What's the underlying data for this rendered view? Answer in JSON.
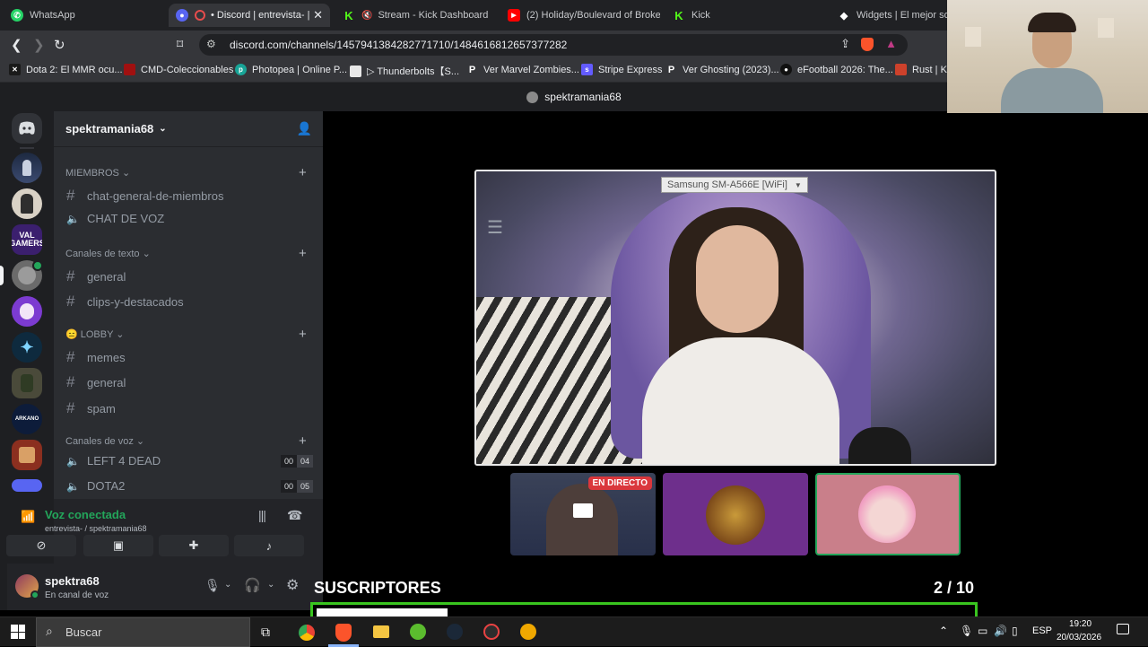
{
  "browser": {
    "tabs": [
      {
        "label": "WhatsApp",
        "icon": "whatsapp-icon",
        "active": false
      },
      {
        "label": "• Discord | entrevista- | s",
        "icon": "discord-icon",
        "active": true
      },
      {
        "label": "Stream - Kick Dashboard",
        "icon": "kick-icon",
        "active": false
      },
      {
        "label": "(2) Holiday/Boulevard of Broken",
        "icon": "youtube-icon",
        "active": false
      },
      {
        "label": "Kick",
        "icon": "kick-icon",
        "active": false
      },
      {
        "label": "Widgets | El mejor softw",
        "icon": "widget-icon",
        "active": false
      }
    ],
    "url": "discord.com/channels/1457941384282771710/1484616812657377282",
    "bookmarks": [
      "Dota 2: El MMR ocu...",
      "CMD-Coleccionables",
      "Photopea | Online P...",
      "▷ Thunderbolts【S...",
      "Ver Marvel Zombies...",
      "Stripe Express",
      "Ver Ghosting (2023)...",
      "eFootball 2026: The...",
      "Rust | Kic"
    ]
  },
  "discord": {
    "top_title": "spektramania68",
    "server_name": "spektramania68",
    "categories": {
      "miembros": "MIEMBROS",
      "texto": "Canales de texto",
      "lobby": "😑 LOBBY",
      "voz": "Canales de voz"
    },
    "channels": {
      "chat_general": "chat-general-de-miembros",
      "chat_voz": "CHAT DE VOZ",
      "general1": "general",
      "clips": "clips-y-destacados",
      "memes": "memes",
      "general2": "general",
      "spam": "spam",
      "l4d": "LEFT 4 DEAD",
      "l4d_a": "00",
      "l4d_b": "04",
      "dota": "DOTA2",
      "dota_a": "00",
      "dota_b": "05"
    },
    "voice": {
      "status": "Voz conectada",
      "location": "entrevista- / spektramania68"
    },
    "user": {
      "name": "spektra68",
      "status": "En canal de voz"
    },
    "srv_labels": {
      "val": "VAL GAMERS",
      "arkano": "ARKANO"
    },
    "stage": {
      "device_label": "Samsung SM-A566E [WiFi]"
    },
    "live_badge": "EN DIRECTO"
  },
  "overlay": {
    "label": "SUSCRIPTORES",
    "current": "2",
    "goal": "/ 10",
    "progress": 0.2
  },
  "taskbar": {
    "search": "Buscar",
    "lang": "ESP",
    "time": "19:20",
    "date": "20/03/2026"
  },
  "colors": {
    "accent_green": "#23a55a",
    "overlay_green": "#39c51f"
  }
}
